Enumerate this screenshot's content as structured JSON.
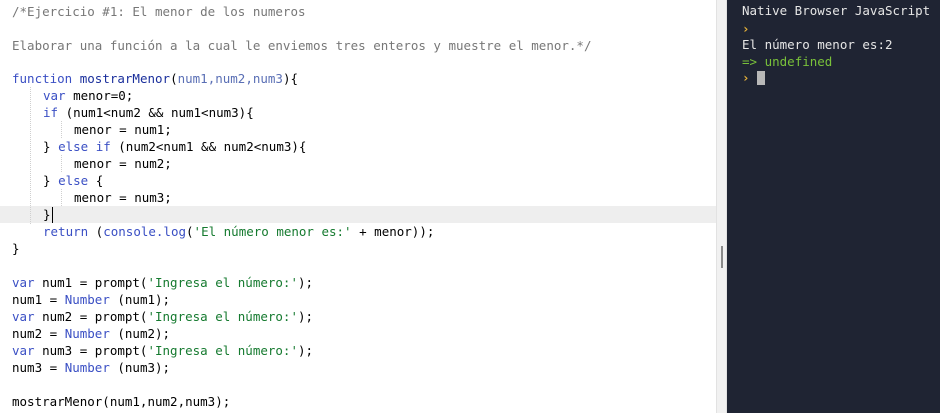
{
  "editor": {
    "line_01": {
      "text": "/*Ejercicio #1: El menor de los numeros"
    },
    "line_03": {
      "text": "Elaborar una función a la cual le enviemos tres enteros y muestre el menor.*/"
    },
    "line_05": {
      "kw": "function",
      "name": " mostrarMenor",
      "open": "(",
      "params": "num1,num2,num3",
      "close": "){"
    },
    "line_06": {
      "kw": "var",
      "rest": " menor=0;"
    },
    "line_07": {
      "kw": "if",
      "rest": " (num1<num2 && num1<num3){"
    },
    "line_08": {
      "rest": "menor = num1;"
    },
    "line_09": {
      "brace": "} ",
      "kw": "else if",
      "rest": " (num2<num1 && num2<num3){"
    },
    "line_10": {
      "rest": "menor = num2;"
    },
    "line_11": {
      "brace": "} ",
      "kw": "else",
      "rest": " {"
    },
    "line_12": {
      "rest": "menor = num3;"
    },
    "line_13": {
      "rest": "}"
    },
    "line_14": {
      "kw": "return",
      "rest1": " (",
      "fn": "console.log",
      "rest2": "(",
      "str": "'El número menor es:'",
      "rest3": " + menor));"
    },
    "line_15": {
      "rest": "}"
    },
    "line_17": {
      "kw": "var",
      "rest1": " num1 = prompt(",
      "str": "'Ingresa el número:'",
      "rest2": ");"
    },
    "line_18": {
      "rest1": "num1 = ",
      "fn": "Number",
      "rest2": " (num1);"
    },
    "line_19": {
      "kw": "var",
      "rest1": " num2 = prompt(",
      "str": "'Ingresa el número:'",
      "rest2": ");"
    },
    "line_20": {
      "rest1": "num2 = ",
      "fn": "Number",
      "rest2": " (num2);"
    },
    "line_21": {
      "kw": "var",
      "rest1": " num3 = prompt(",
      "str": "'Ingresa el número:'",
      "rest2": ");"
    },
    "line_22": {
      "rest1": "num3 = ",
      "fn": "Number",
      "rest2": " (num3);"
    },
    "line_24": {
      "rest": "mostrarMenor(num1,num2,num3);"
    }
  },
  "console": {
    "title": "Native Browser JavaScript",
    "prompt_symbol": "›",
    "output_line": "El número menor es:2",
    "result_arrow": "=>",
    "result_value": "undefined"
  },
  "colors": {
    "comment": "#777777",
    "keyword": "#3a4fc4",
    "string": "#157a2f",
    "console_bg": "#1f2433",
    "console_prompt": "#e8b33a",
    "console_result": "#79c13a"
  }
}
